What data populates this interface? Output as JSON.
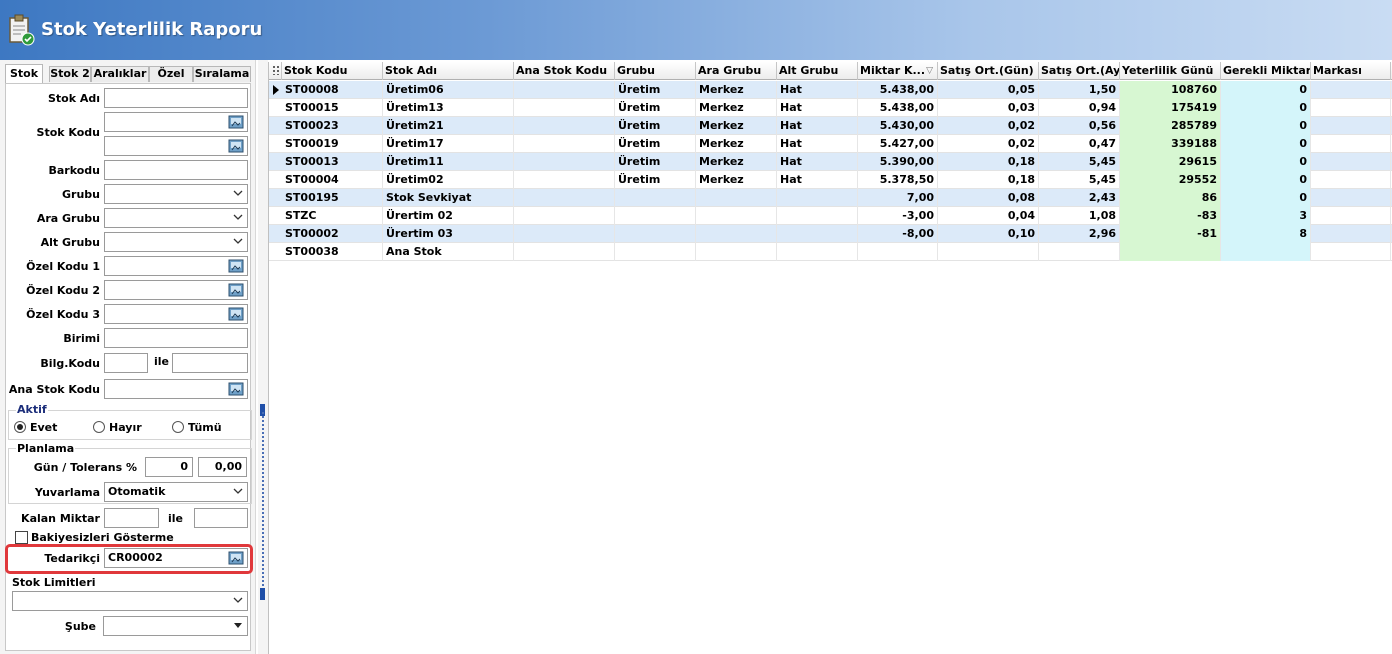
{
  "window": {
    "title": "Stok Yeterlilik Raporu"
  },
  "tabs": [
    "Stok",
    "Stok 2",
    "Aralıklar",
    "Özel",
    "Sıralama"
  ],
  "form": {
    "stok_adi_label": "Stok Adı",
    "stok_kodu_label": "Stok Kodu",
    "barkodu_label": "Barkodu",
    "grubu_label": "Grubu",
    "ara_grubu_label": "Ara Grubu",
    "alt_grubu_label": "Alt Grubu",
    "ozel_kodu1_label": "Özel Kodu 1",
    "ozel_kodu2_label": "Özel Kodu 2",
    "ozel_kodu3_label": "Özel Kodu 3",
    "birimi_label": "Birimi",
    "bilg_kodu_label": "Bilg.Kodu",
    "ile_label": "ile",
    "ana_stok_kodu_label": "Ana Stok Kodu",
    "aktif_title": "Aktif",
    "aktif_options": [
      "Evet",
      "Hayır",
      "Tümü"
    ],
    "aktif_selected": "Evet",
    "planlama_title": "Planlama",
    "gun_tolerans_label": "Gün / Tolerans %",
    "gun_value": "0",
    "tolerans_value": "0,00",
    "yuvarlama_label": "Yuvarlama",
    "yuvarlama_value": "Otomatik",
    "kalan_miktar_label": "Kalan Miktar",
    "kalan_ile_label": "ile",
    "bakiyesizleri_label": "Bakiyesizleri Gösterme",
    "tedarikci_label": "Tedarikçi",
    "tedarikci_value": "CR00002",
    "stok_limitleri_label": "Stok Limitleri",
    "sube_label": "Şube"
  },
  "grid": {
    "columns": [
      "Stok Kodu",
      "Stok Adı",
      "Ana Stok Kodu",
      "Grubu",
      "Ara Grubu",
      "Alt Grubu",
      "Miktar K...",
      "Satış Ort.(Gün)",
      "Satış Ort.(Ay)",
      "Yeterlilik Günü",
      "Gerekli Miktar",
      "Markası"
    ],
    "rows": [
      [
        "ST00008",
        "Üretim06",
        "",
        "Üretim",
        "Merkez",
        "Hat",
        "5.438,00",
        "0,05",
        "1,50",
        "108760",
        "0",
        ""
      ],
      [
        "ST00015",
        "Üretim13",
        "",
        "Üretim",
        "Merkez",
        "Hat",
        "5.438,00",
        "0,03",
        "0,94",
        "175419",
        "0",
        ""
      ],
      [
        "ST00023",
        "Üretim21",
        "",
        "Üretim",
        "Merkez",
        "Hat",
        "5.430,00",
        "0,02",
        "0,56",
        "285789",
        "0",
        ""
      ],
      [
        "ST00019",
        "Üretim17",
        "",
        "Üretim",
        "Merkez",
        "Hat",
        "5.427,00",
        "0,02",
        "0,47",
        "339188",
        "0",
        ""
      ],
      [
        "ST00013",
        "Üretim11",
        "",
        "Üretim",
        "Merkez",
        "Hat",
        "5.390,00",
        "0,18",
        "5,45",
        "29615",
        "0",
        ""
      ],
      [
        "ST00004",
        "Üretim02",
        "",
        "Üretim",
        "Merkez",
        "Hat",
        "5.378,50",
        "0,18",
        "5,45",
        "29552",
        "0",
        ""
      ],
      [
        "ST00195",
        "Stok Sevkiyat",
        "",
        "",
        "",
        "",
        "7,00",
        "0,08",
        "2,43",
        "86",
        "0",
        ""
      ],
      [
        "STZC",
        "Ürertim 02",
        "",
        "",
        "",
        "",
        "-3,00",
        "0,04",
        "1,08",
        "-83",
        "3",
        ""
      ],
      [
        "ST00002",
        "Ürertim 03",
        "",
        "",
        "",
        "",
        "-8,00",
        "0,10",
        "2,96",
        "-81",
        "8",
        ""
      ],
      [
        "ST00038",
        "Ana Stok",
        "",
        "",
        "",
        "",
        "",
        "",
        "",
        "",
        "",
        ""
      ]
    ]
  },
  "colors": {
    "row_alt": "#dceaf9",
    "yeterlilik_bg": "#d7f7d2",
    "gerekli_bg": "#d4f5fa",
    "highlight": "#e0383b"
  }
}
